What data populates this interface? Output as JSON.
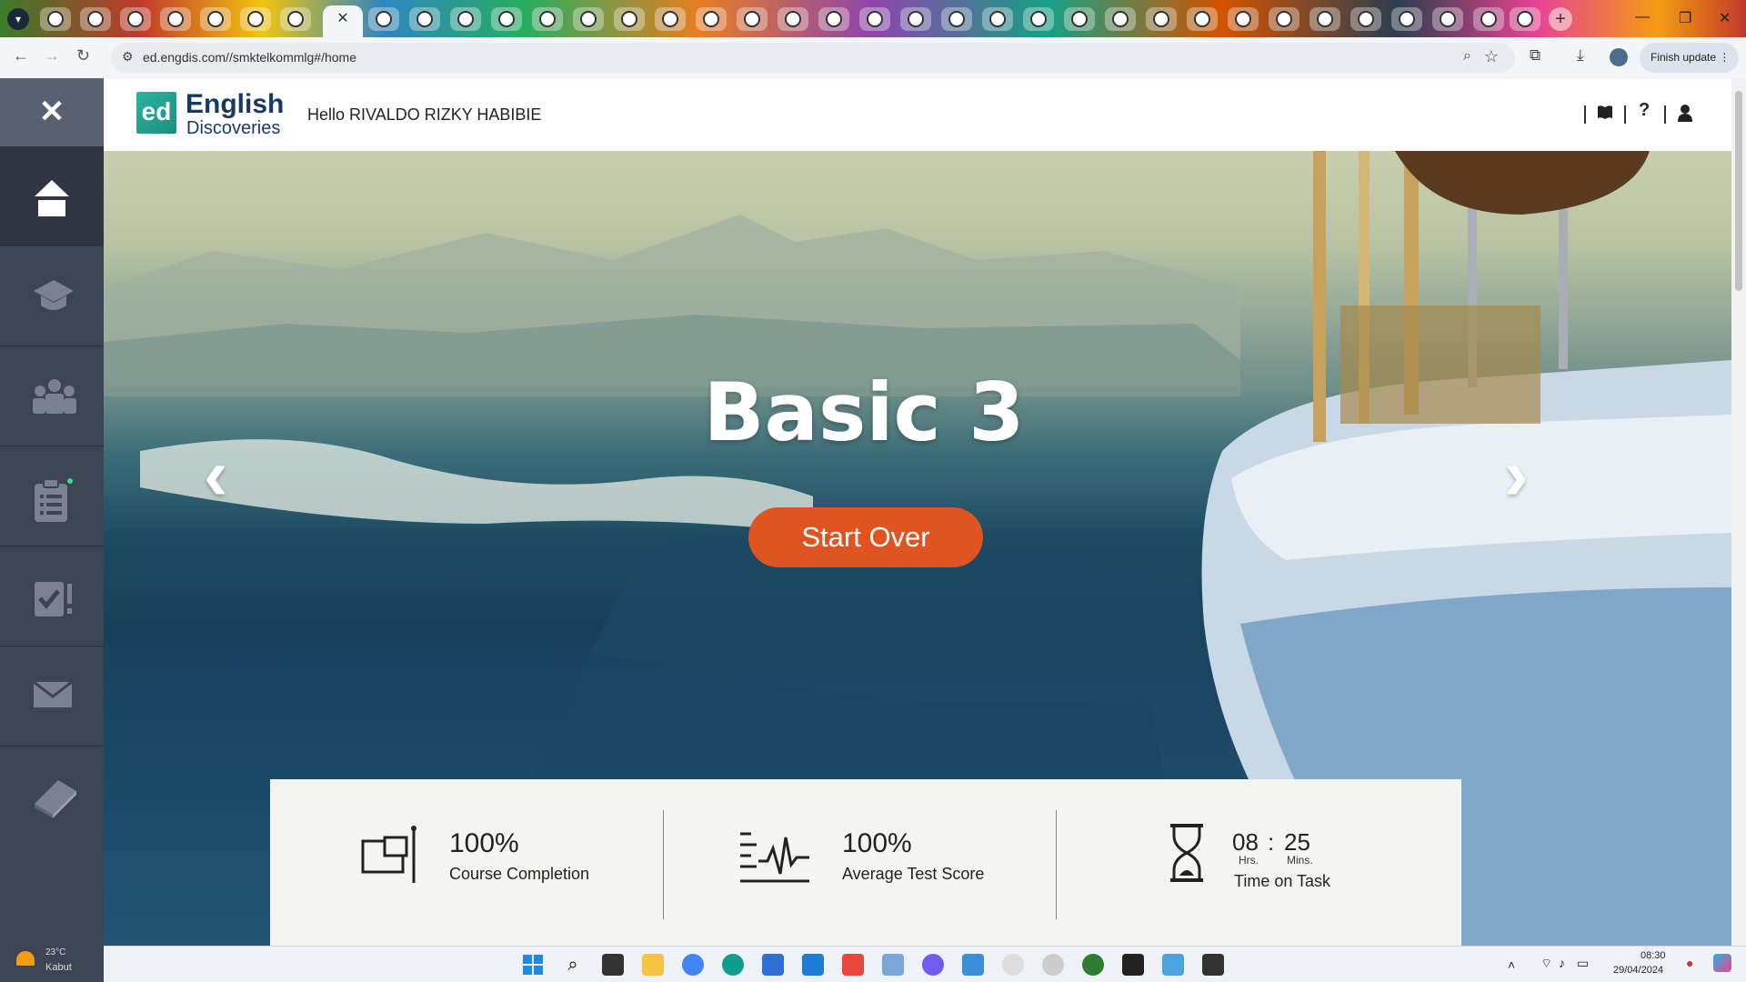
{
  "browser": {
    "url": "ed.engdis.com//smktelkommlg#/home",
    "finish_update_label": "Finish update",
    "active_tab_close": "✕",
    "new_tab_label": "+"
  },
  "app": {
    "logo_mark": "ed",
    "logo_line1": "English",
    "logo_line2": "Discoveries",
    "greeting": "Hello RIVALDO RIZKY HABIBIE",
    "close_label": "✕"
  },
  "sidebar": {
    "items": [
      {
        "name": "home",
        "icon": "home-icon"
      },
      {
        "name": "courses",
        "icon": "graduation-cap-icon"
      },
      {
        "name": "community",
        "icon": "group-icon"
      },
      {
        "name": "assignments",
        "icon": "clipboard-list-icon"
      },
      {
        "name": "tests",
        "icon": "test-check-icon"
      },
      {
        "name": "messages",
        "icon": "envelope-icon"
      },
      {
        "name": "resources",
        "icon": "book-icon"
      }
    ]
  },
  "hero": {
    "title": "Basic 3",
    "button_label": "Start Over",
    "prev_label": "‹",
    "next_label": "›"
  },
  "stats": {
    "completion_value": "100%",
    "completion_label": "Course Completion",
    "score_value": "100%",
    "score_label": "Average Test Score",
    "time_hours": "08",
    "time_sep": ":",
    "time_minutes": "25",
    "hours_unit": "Hrs.",
    "minutes_unit": "Mins.",
    "time_label": "Time on Task"
  },
  "taskbar": {
    "weather_temp": "23°C",
    "weather_cond": "Kabut",
    "time": "08:30",
    "date": "29/04/2024"
  },
  "colors": {
    "sidebar": "#3d4453",
    "accent_button": "#e05421",
    "logo_teal": "#2bb3a0",
    "logo_navy": "#173a63"
  }
}
